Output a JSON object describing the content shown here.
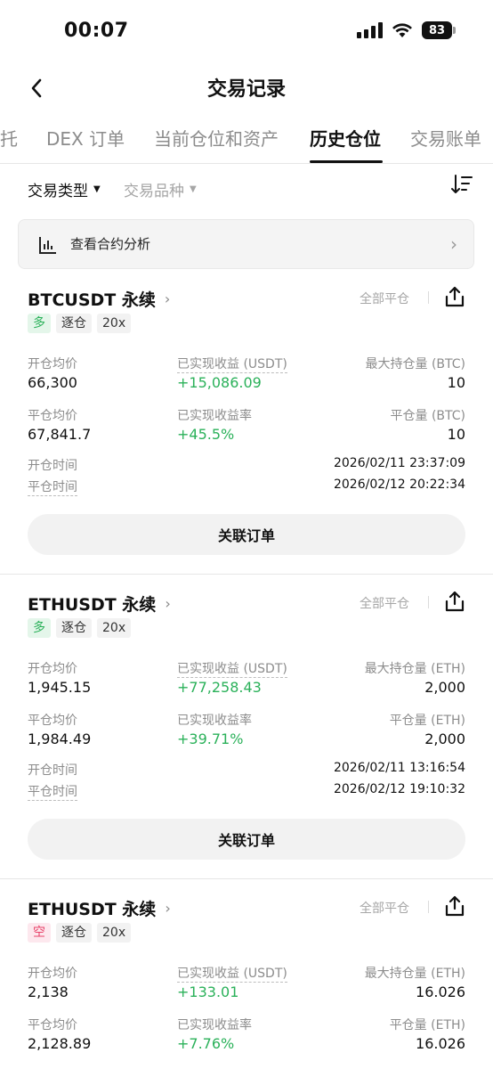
{
  "status_bar": {
    "time": "00:07",
    "battery": "83"
  },
  "header": {
    "title": "交易记录"
  },
  "tabs": [
    {
      "label": "托"
    },
    {
      "label": "DEX 订单"
    },
    {
      "label": "当前仓位和资产"
    },
    {
      "label": "历史仓位"
    },
    {
      "label": "交易账单"
    }
  ],
  "filters": {
    "trade_type": "交易类型",
    "trade_symbol": "交易品种"
  },
  "analysis": {
    "label": "查看合约分析"
  },
  "positions": [
    {
      "symbol": "BTCUSDT 永续",
      "close_type": "全部平仓",
      "tags": {
        "side": "多",
        "margin": "逐仓",
        "leverage": "20x"
      },
      "open_avg_label": "开仓均价",
      "open_avg": "66,300",
      "pnl_label": "已实现收益 (USDT)",
      "pnl": "+15,086.09",
      "max_label": "最大持仓量 (BTC)",
      "max": "10",
      "close_avg_label": "平仓均价",
      "close_avg": "67,841.7",
      "pnl_rate_label": "已实现收益率",
      "pnl_rate": "+45.5%",
      "close_qty_label": "平仓量 (BTC)",
      "close_qty": "10",
      "open_time_label": "开仓时间",
      "open_time": "2026/02/11 23:37:09",
      "close_time_label": "平仓时间",
      "close_time": "2026/02/12 20:22:34",
      "button": "关联订单"
    },
    {
      "symbol": "ETHUSDT 永续",
      "close_type": "全部平仓",
      "tags": {
        "side": "多",
        "margin": "逐仓",
        "leverage": "20x"
      },
      "open_avg_label": "开仓均价",
      "open_avg": "1,945.15",
      "pnl_label": "已实现收益 (USDT)",
      "pnl": "+77,258.43",
      "max_label": "最大持仓量 (ETH)",
      "max": "2,000",
      "close_avg_label": "平仓均价",
      "close_avg": "1,984.49",
      "pnl_rate_label": "已实现收益率",
      "pnl_rate": "+39.71%",
      "close_qty_label": "平仓量 (ETH)",
      "close_qty": "2,000",
      "open_time_label": "开仓时间",
      "open_time": "2026/02/11 13:16:54",
      "close_time_label": "平仓时间",
      "close_time": "2026/02/12 19:10:32",
      "button": "关联订单"
    },
    {
      "symbol": "ETHUSDT 永续",
      "close_type": "全部平仓",
      "tags": {
        "side": "空",
        "margin": "逐仓",
        "leverage": "20x"
      },
      "open_avg_label": "开仓均价",
      "open_avg": "2,138",
      "pnl_label": "已实现收益 (USDT)",
      "pnl": "+133.01",
      "max_label": "最大持仓量 (ETH)",
      "max": "16.026",
      "close_avg_label": "平仓均价",
      "close_avg": "2,128.89",
      "pnl_rate_label": "已实现收益率",
      "pnl_rate": "+7.76%",
      "close_qty_label": "平仓量 (ETH)",
      "close_qty": "16.026"
    }
  ],
  "colors": {
    "positive": "#2bb15a",
    "short": "#e8446b",
    "muted": "#8c8c8c"
  }
}
